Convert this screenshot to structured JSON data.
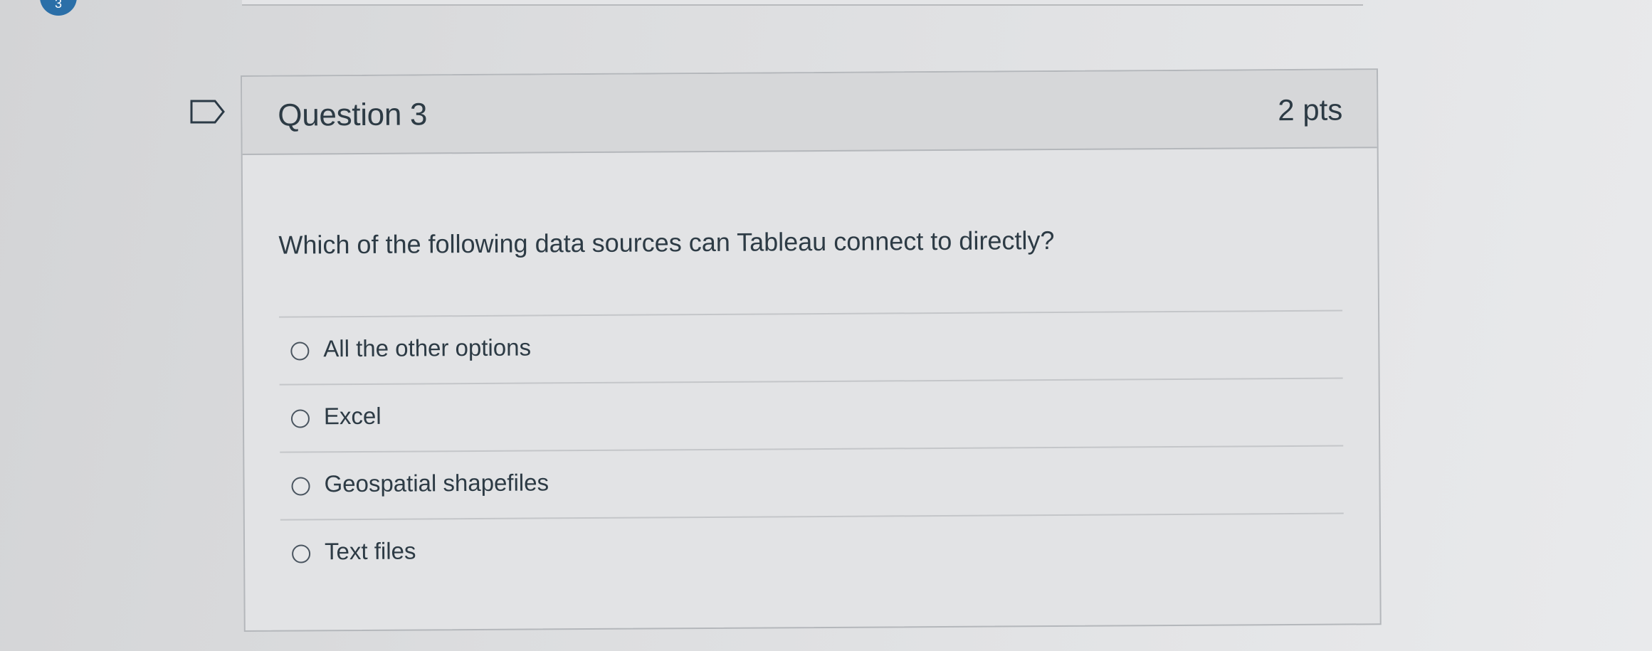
{
  "question": {
    "badge_number": "3",
    "title": "Question 3",
    "points": "2 pts",
    "text": "Which of the following data sources can Tableau connect to directly?",
    "answers": [
      {
        "label": "All the other options",
        "selected": false
      },
      {
        "label": "Excel",
        "selected": false
      },
      {
        "label": "Geospatial shapefiles",
        "selected": false
      },
      {
        "label": "Text files",
        "selected": false
      }
    ]
  },
  "colors": {
    "text": "#2d3b45",
    "header_background": "#d6d7d9",
    "badge": "#2b6fa8"
  },
  "icons": {
    "flag": "flag-question-icon"
  }
}
